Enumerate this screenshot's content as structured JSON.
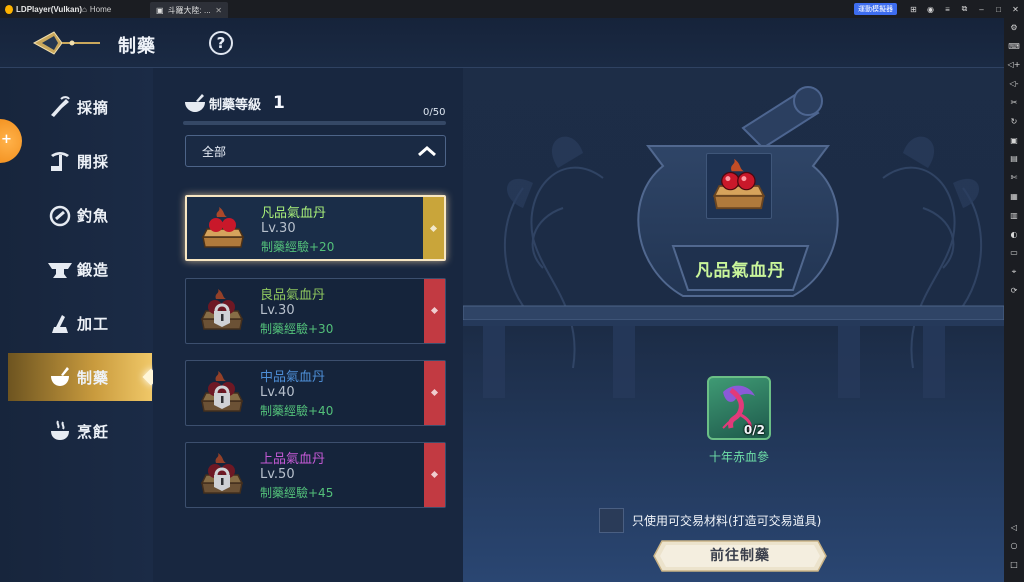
{
  "emulator": {
    "app_title": "LDPlayer(Vulkan)",
    "home_label": "Home",
    "tab_label": "斗羅大陸: ...",
    "badge_label": "運動模擬器",
    "window_controls": [
      "gamepad-icon",
      "user-icon",
      "menu-icon",
      "restore-icon",
      "minimize-icon",
      "maximize-icon",
      "close-icon"
    ],
    "toolbar_icons": [
      "settings-icon",
      "keyboard-icon",
      "volume-up-icon",
      "volume-down-icon",
      "screenshot-icon",
      "sync-icon",
      "record-icon",
      "screen-icon",
      "scissors-icon",
      "apk-icon",
      "multi-window-icon",
      "shake-icon",
      "folder-icon",
      "location-icon",
      "rotate-icon",
      "back-icon",
      "home-icon",
      "recent-icon"
    ]
  },
  "header": {
    "title": "制藥",
    "help": "?"
  },
  "categories": [
    {
      "label": "採摘",
      "icon": "pick-icon",
      "active": false
    },
    {
      "label": "開採",
      "icon": "mining-icon",
      "active": false
    },
    {
      "label": "釣魚",
      "icon": "fishing-icon",
      "active": false
    },
    {
      "label": "鍛造",
      "icon": "anvil-icon",
      "active": false
    },
    {
      "label": "加工",
      "icon": "processing-icon",
      "active": false
    },
    {
      "label": "制藥",
      "icon": "mortar-icon",
      "active": true
    },
    {
      "label": "烹飪",
      "icon": "cooking-icon",
      "active": false
    }
  ],
  "craft_level": {
    "label": "制藥等級",
    "value": "1",
    "exp_text": "0/50",
    "exp_fraction": 0
  },
  "filter": {
    "selected": "全部"
  },
  "recipes": [
    {
      "name": "凡品氣血丹",
      "level": "Lv.30",
      "exp": "制藥經驗+20",
      "name_color": "#a9f07a",
      "tag_color": "#c9a53a",
      "selected": true,
      "locked": false
    },
    {
      "name": "良品氣血丹",
      "level": "Lv.30",
      "exp": "制藥經驗+30",
      "name_color": "#8fc85f",
      "tag_color": "#c23a42",
      "selected": false,
      "locked": true
    },
    {
      "name": "中品氣血丹",
      "level": "Lv.40",
      "exp": "制藥經驗+40",
      "name_color": "#4d8ed6",
      "tag_color": "#c23a42",
      "selected": false,
      "locked": true
    },
    {
      "name": "上品氣血丹",
      "level": "Lv.50",
      "exp": "制藥經驗+45",
      "name_color": "#c55ad6",
      "tag_color": "#c23a42",
      "selected": false,
      "locked": true
    }
  ],
  "detail": {
    "product_name": "凡品氣血丹",
    "material_name": "十年赤血參",
    "material_count": "0/2",
    "trade_only_label": "只使用可交易材料(打造可交易道具)",
    "trade_only_checked": false,
    "craft_button": "前往制藥"
  }
}
